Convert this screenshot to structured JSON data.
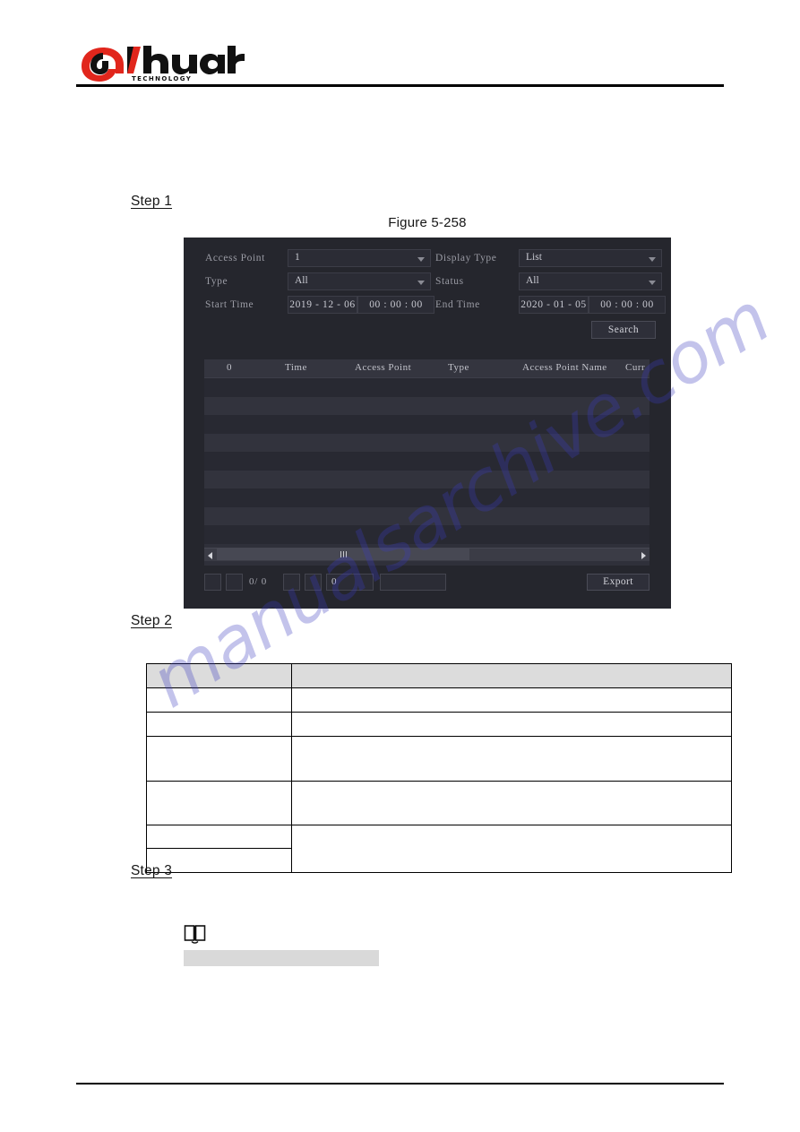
{
  "header": {
    "brand": "alhua",
    "brand_sub": "TECHNOLOGY"
  },
  "steps": {
    "step1": "Step 1",
    "step2": "Step 2",
    "step3": "Step 3"
  },
  "figure": {
    "caption": "Figure 5-258"
  },
  "device_ui": {
    "form": {
      "access_point": {
        "label": "Access Point",
        "value": "1"
      },
      "display_type": {
        "label": "Display Type",
        "value": "List"
      },
      "type": {
        "label": "Type",
        "value": "All"
      },
      "status": {
        "label": "Status",
        "value": "All"
      },
      "start_time": {
        "label": "Start Time",
        "date": "2019 - 12 - 06",
        "time": "00 : 00 : 00"
      },
      "end_time": {
        "label": "End Time",
        "date": "2020 - 01 - 05",
        "time": "00 : 00 : 00"
      },
      "search_button": "Search"
    },
    "table": {
      "columns": [
        "0",
        "Time",
        "Access Point",
        "Type",
        "Access Point Name",
        "Curr"
      ],
      "rows": []
    },
    "pagination": {
      "count": "0/  0",
      "page_input": "0",
      "export_button": "Export"
    }
  },
  "param_table": {
    "columns": [
      "",
      ""
    ],
    "rows": [
      [
        "",
        ""
      ],
      [
        "",
        ""
      ],
      [
        "",
        ""
      ],
      [
        "",
        ""
      ],
      [
        "",
        ""
      ],
      [
        "",
        ""
      ]
    ]
  },
  "note": {
    "icon": "book-icon",
    "redacted_text": ""
  },
  "watermark": {
    "text": "manualsarchive.com"
  },
  "colors": {
    "panel_bg": "#25262d",
    "table_bg": "#2f303a",
    "row_even": "#32333d",
    "row_odd": "#282932",
    "brand_red": "#e1261c",
    "header_gray": "#dcdcdc",
    "watermark_blue": "#3b3bbf"
  }
}
